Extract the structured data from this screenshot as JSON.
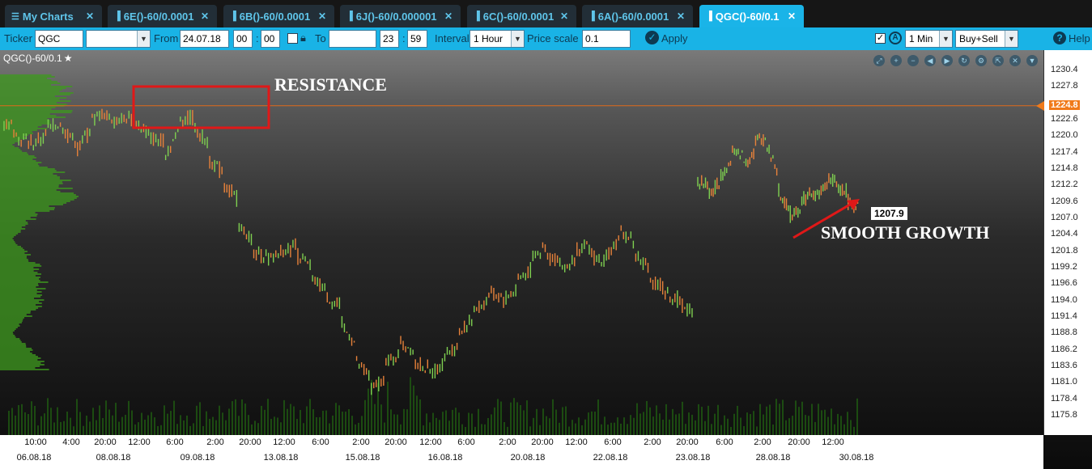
{
  "tabs": [
    {
      "label": "My Charts",
      "icon": "menu-icon",
      "active": false
    },
    {
      "label": "6E()-60/0.0001",
      "icon": "bar-chart-icon",
      "active": false
    },
    {
      "label": "6B()-60/0.0001",
      "icon": "bar-chart-icon",
      "active": false
    },
    {
      "label": "6J()-60/0.000001",
      "icon": "bar-chart-icon",
      "active": false
    },
    {
      "label": "6C()-60/0.0001",
      "icon": "bar-chart-icon",
      "active": false
    },
    {
      "label": "6A()-60/0.0001",
      "icon": "bar-chart-icon",
      "active": false
    },
    {
      "label": "QGC()-60/0.1",
      "icon": "bar-chart-icon",
      "active": true
    }
  ],
  "toolbar": {
    "ticker_label": "Ticker",
    "ticker_value": "QGC",
    "ticker_extra": "",
    "from_label": "From",
    "from_date": "24.07.18",
    "from_hour": "00",
    "from_min": "00",
    "to_label": "To",
    "to_date": "",
    "to_hour": "23",
    "to_min": "59",
    "interval_label": "Interval",
    "interval_value": "1 Hour",
    "price_scale_label": "Price scale",
    "price_scale_value": "0.1",
    "apply_label": "Apply",
    "timeframe_value": "1 Min",
    "side_value": "Buy+Sell",
    "help_label": "Help"
  },
  "chart_header": {
    "title": "QGC()-60/0.1",
    "star": "★"
  },
  "annotations": {
    "resistance": "RESISTANCE",
    "smooth_growth": "SMOOTH GROWTH"
  },
  "colors": {
    "accent": "#1ab4e8",
    "up_bar": "#e8823a",
    "down_bar": "#7fd050",
    "price_line": "#e06a1a",
    "annotation_box": "#e01818",
    "last_price_bg": "#ffffff",
    "current_price_bg": "#f07a1a"
  },
  "chart_data": {
    "type": "bar",
    "instrument": "QGC()-60/0.1",
    "interval": "1 Hour",
    "y_ticks": [
      "1230.4",
      "1227.8",
      "1224.8",
      "1222.6",
      "1220.0",
      "1217.4",
      "1214.8",
      "1212.2",
      "1209.6",
      "1207.0",
      "1204.4",
      "1201.8",
      "1199.2",
      "1196.6",
      "1194.0",
      "1191.4",
      "1188.8",
      "1186.2",
      "1183.6",
      "1181.0",
      "1178.4",
      "1175.8"
    ],
    "ylim": [
      1175.8,
      1230.4
    ],
    "current_price_label": "1224.8",
    "last_price_label": "1207.9",
    "x_time_ticks": [
      "10:00",
      "4:00",
      "20:00",
      "12:00",
      "6:00",
      "2:00",
      "20:00",
      "12:00",
      "6:00",
      "2:00",
      "20:00",
      "12:00",
      "6:00",
      "2:00",
      "20:00",
      "12:00",
      "6:00",
      "2:00",
      "20:00",
      "6:00",
      "2:00",
      "20:00",
      "12:00"
    ],
    "x_date_ticks": [
      "06.08.18",
      "08.08.18",
      "09.08.18",
      "13.08.18",
      "15.08.18",
      "16.08.18",
      "20.08.18",
      "22.08.18",
      "23.08.18",
      "28.08.18",
      "30.08.18"
    ],
    "price_path": [
      [
        1223.5,
        1222.0
      ],
      [
        1221.0,
        1219.5
      ],
      [
        1219.0,
        1218.5
      ],
      [
        1220.5,
        1221.5
      ],
      [
        1222.0,
        1221.0
      ],
      [
        1219.0,
        1218.0
      ],
      [
        1221.5,
        1222.8
      ],
      [
        1223.5,
        1223.0
      ],
      [
        1222.5,
        1222.8
      ],
      [
        1223.0,
        1222.0
      ],
      [
        1220.0,
        1219.5
      ],
      [
        1219.0,
        1217.0
      ],
      [
        1221.5,
        1222.8
      ],
      [
        1223.0,
        1221.0
      ],
      [
        1219.0,
        1216.0
      ],
      [
        1214.0,
        1212.0
      ],
      [
        1210.0,
        1206.0
      ],
      [
        1203.0,
        1201.0
      ],
      [
        1201.5,
        1200.5
      ],
      [
        1201.8,
        1202.0
      ],
      [
        1202.5,
        1201.0
      ],
      [
        1199.0,
        1197.0
      ],
      [
        1196.0,
        1194.5
      ],
      [
        1193.0,
        1190.0
      ],
      [
        1187.0,
        1184.0
      ],
      [
        1181.5,
        1180.0
      ],
      [
        1182.0,
        1184.0
      ],
      [
        1186.0,
        1187.5
      ],
      [
        1186.0,
        1184.0
      ],
      [
        1183.0,
        1182.5
      ],
      [
        1184.0,
        1185.5
      ],
      [
        1187.0,
        1189.0
      ],
      [
        1191.0,
        1192.5
      ],
      [
        1194.0,
        1195.0
      ],
      [
        1194.5,
        1194.0
      ],
      [
        1196.0,
        1197.5
      ],
      [
        1199.0,
        1201.0
      ],
      [
        1202.5,
        1201.0
      ],
      [
        1200.0,
        1199.0
      ],
      [
        1200.5,
        1202.0
      ],
      [
        1202.5,
        1201.0
      ],
      [
        1200.0,
        1201.5
      ],
      [
        1203.5,
        1205.0
      ],
      [
        1203.0,
        1201.0
      ],
      [
        1199.0,
        1197.0
      ],
      [
        1196.0,
        1195.0
      ],
      [
        1194.0,
        1193.5
      ],
      [
        1192.0,
        1192.5
      ],
      [
        1214.0,
        1213.0
      ],
      [
        1212.0,
        1211.0
      ],
      [
        1212.5,
        1214.0
      ],
      [
        1216.0,
        1217.5
      ],
      [
        1217.0,
        1216.0
      ],
      [
        1217.5,
        1219.0
      ],
      [
        1220.0,
        1218.5
      ],
      [
        1214.0,
        1211.0
      ],
      [
        1208.0,
        1207.5
      ],
      [
        1209.0,
        1210.0
      ],
      [
        1211.0,
        1210.5
      ],
      [
        1211.5,
        1212.5
      ],
      [
        1213.0,
        1212.0
      ],
      [
        1211.0,
        1209.5
      ],
      [
        1208.5,
        1207.9
      ]
    ]
  }
}
